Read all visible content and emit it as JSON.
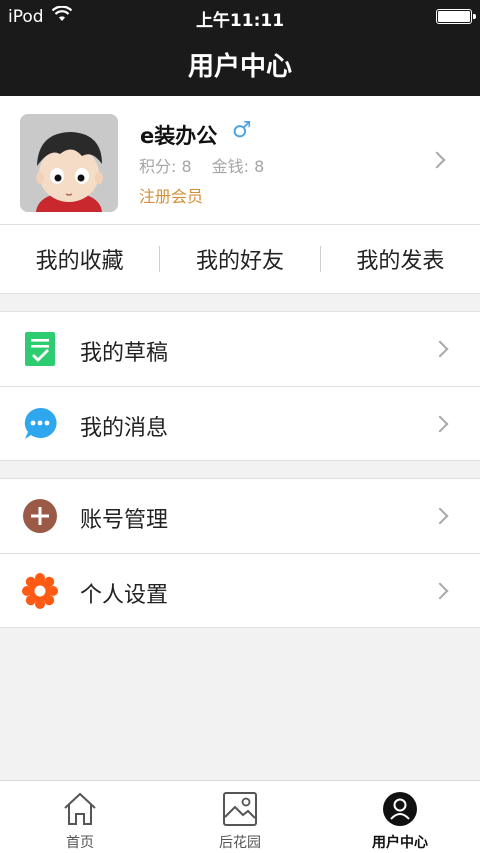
{
  "status_bar": {
    "carrier": "iPod",
    "time": "上午11:11"
  },
  "nav": {
    "title": "用户中心"
  },
  "profile": {
    "name": "e装办公",
    "gender_symbol": "♂",
    "points": "积分: 8",
    "money": "金钱: 8",
    "register_link": "注册会员"
  },
  "quick_tabs": [
    {
      "label": "我的收藏"
    },
    {
      "label": "我的好友"
    },
    {
      "label": "我的发表"
    }
  ],
  "menu_groups": [
    {
      "items": [
        {
          "label": "我的草稿",
          "icon": "draft-icon",
          "color": "#2ecc71"
        },
        {
          "label": "我的消息",
          "icon": "message-icon",
          "color": "#2fa7ee"
        }
      ]
    },
    {
      "items": [
        {
          "label": "账号管理",
          "icon": "account-icon",
          "color": "#9b5a48"
        },
        {
          "label": "个人设置",
          "icon": "settings-icon",
          "color": "#ff5a14"
        }
      ]
    }
  ],
  "tab_bar": {
    "items": [
      {
        "label": "首页",
        "icon": "home-icon",
        "active": false
      },
      {
        "label": "后花园",
        "icon": "garden-icon",
        "active": false
      },
      {
        "label": "用户中心",
        "icon": "user-icon",
        "active": true
      }
    ]
  },
  "colors": {
    "bar_bg": "#1a1a1a",
    "accent_orange": "#d4903a",
    "gender_blue": "#4aa3e8"
  }
}
